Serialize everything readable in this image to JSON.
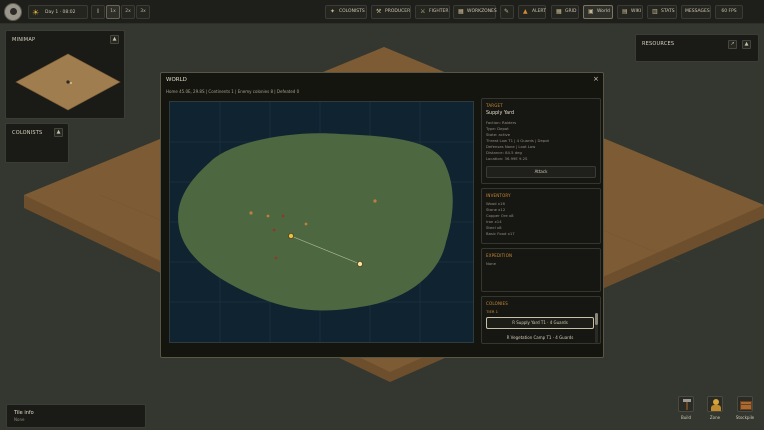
{
  "topbar": {
    "day": "Day 1 · 08:02",
    "speeds": [
      "||",
      "1x",
      "2x",
      "3x"
    ],
    "active_speed": 1,
    "nav": [
      {
        "label": "COLONISTS",
        "icon": "people-icon"
      },
      {
        "label": "PRODUCER",
        "icon": "hammer-icon"
      },
      {
        "label": "FIGHTER",
        "icon": "sword-icon"
      },
      {
        "label": "WORKZONES",
        "icon": "zone-icon"
      },
      {
        "label": "",
        "icon": "wrench-icon"
      },
      {
        "label": "ALERT",
        "icon": "alert-icon"
      },
      {
        "label": "GRID",
        "icon": "grid-icon"
      },
      {
        "label": "World",
        "icon": "globe-icon",
        "active": true
      },
      {
        "label": "WIKI",
        "icon": "book-icon"
      },
      {
        "label": "STATS",
        "icon": "chart-icon"
      },
      {
        "label": "MESSAGES",
        "icon": ""
      }
    ],
    "fps": "60 FPS"
  },
  "minimap": {
    "title": "MINIMAP",
    "collapse": "▲"
  },
  "colonists_panel": {
    "title": "COLONISTS",
    "collapse": "▲"
  },
  "resources_panel": {
    "title": "RESOURCES",
    "pin": "↗",
    "collapse": "▲"
  },
  "tile_info": {
    "title": "Tile info",
    "value": "None"
  },
  "world": {
    "title": "WORLD",
    "close": "×",
    "stats": "Home 45.0E, 29.8S  |  Continents 1  |  Enemy colonies 8  |  Defeated 0",
    "target": {
      "heading": "TARGET",
      "name": "Supply Yard",
      "lines": [
        "Faction: Raiders",
        "Type: Depot",
        "State: active",
        "Threat Low T1  |  4 Guards  |  Depot",
        "Defenses None  |  Loot Low",
        "Distance: 84.5 deg",
        "Location: 36.99E 9.2S"
      ],
      "attack": "Attack"
    },
    "inventory": {
      "heading": "INVENTORY",
      "lines": [
        "Wood x16",
        "Stone x12",
        "Copper Ore x8",
        "Iron x14",
        "Steel x8",
        "Basic Food x17"
      ]
    },
    "expedition": {
      "heading": "EXPEDITION",
      "value": "None"
    },
    "colonies": {
      "heading": "COLONIES",
      "tier": "TIER 1",
      "rows": [
        {
          "label": "R  Supply Yard  T1 · 4 Guards",
          "selected": true
        },
        {
          "label": "R  Vegetation Camp  T1 · 4 Guards",
          "selected": false
        }
      ]
    }
  },
  "tools": [
    {
      "label": "Build",
      "icon": "hammer-icon"
    },
    {
      "label": "Zone",
      "icon": "zone-icon"
    },
    {
      "label": "Stockpile",
      "icon": "crate-icon"
    }
  ],
  "colors": {
    "terrain": "#7a5a35",
    "ocean": "#102331",
    "land": "#4d6840",
    "accent": "#c98a36"
  }
}
